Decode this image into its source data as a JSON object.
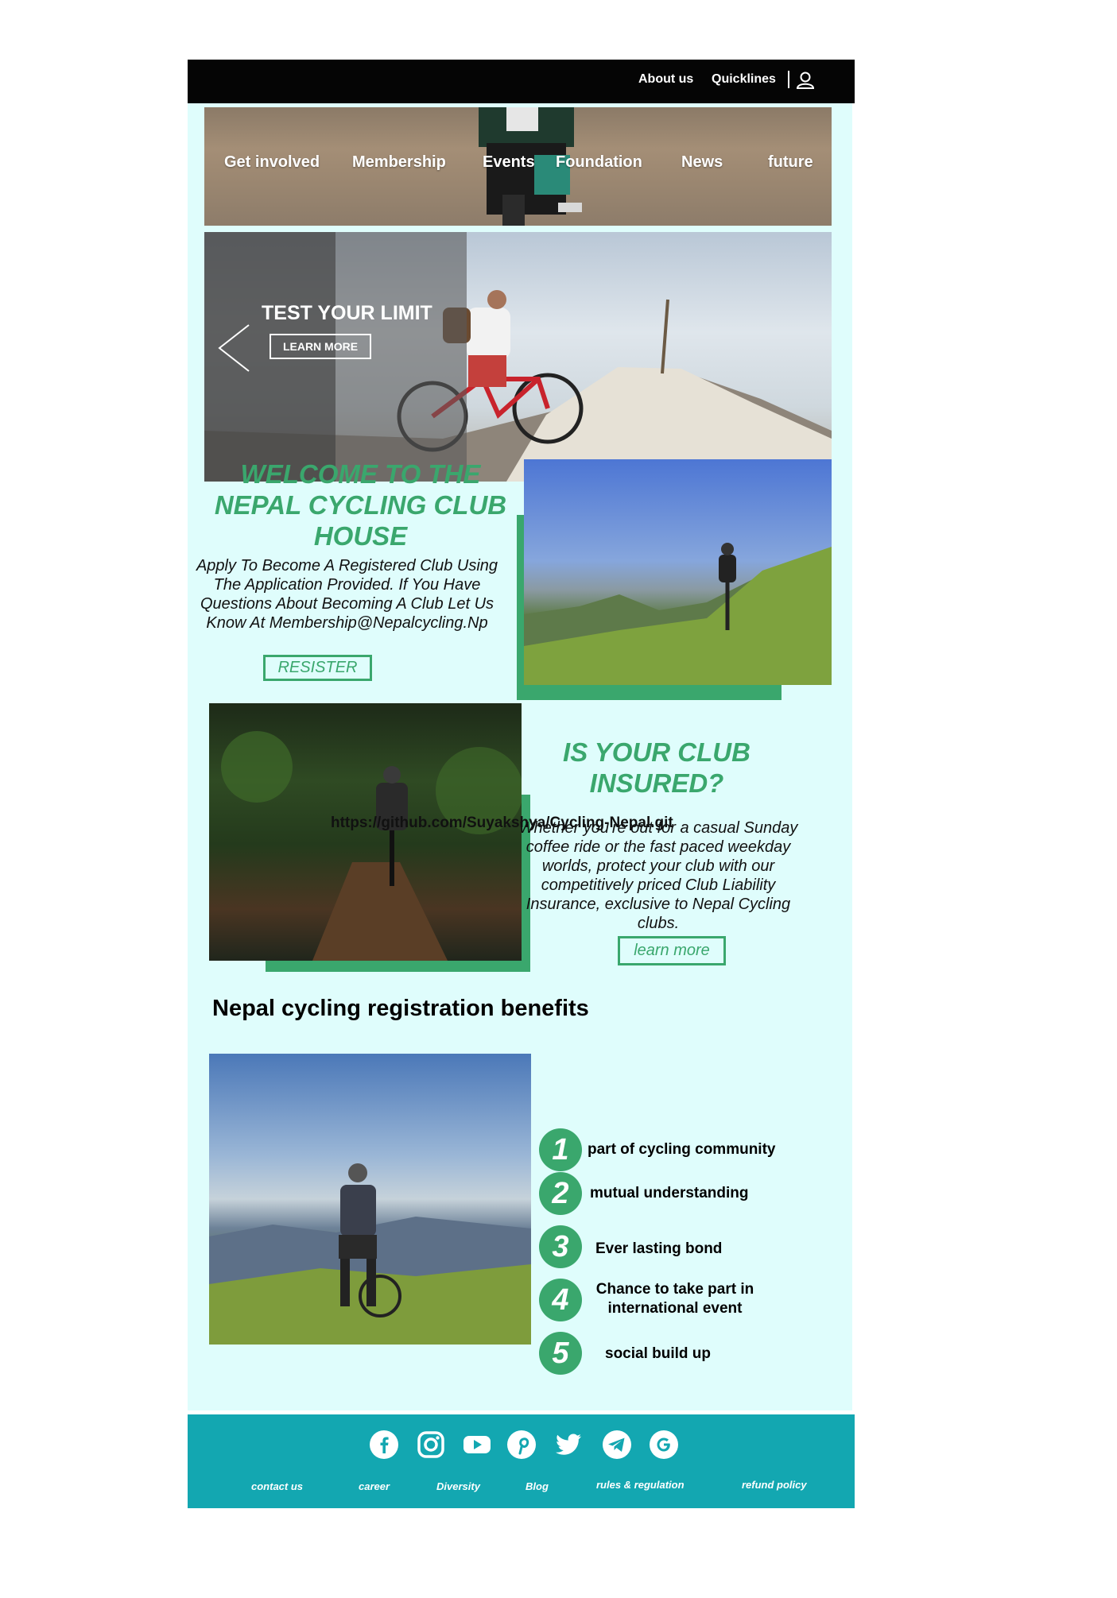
{
  "topbar": {
    "about": "About us",
    "quicklinks": "Quicklines",
    "user_icon": "user-icon"
  },
  "nav": {
    "items": [
      "Get involved",
      "Membership",
      "Events",
      "Foundation",
      "News",
      "future"
    ]
  },
  "hero": {
    "title": "TEST YOUR LIMIT",
    "button": "LEARN MORE",
    "prev_icon": "chevron-left-icon"
  },
  "welcome": {
    "title": "WELCOME TO THE NEPAL CYCLING CLUB HOUSE",
    "text": "Apply To Become A Registered Club Using The Application Provided. If You Have Questions About Becoming A Club Let Us Know At Membership@Nepalcycling.Np",
    "button": "RESISTER"
  },
  "insured": {
    "title": "IS YOUR CLUB INSURED?",
    "text": "Whether you're out for a casual Sunday coffee ride or the fast paced weekday worlds, protect your club with our competitively priced Club Liability Insurance, exclusive to Nepal Cycling clubs.",
    "overlay_link": "https://github.com/Suyakshya/Cycling-Nepal.git",
    "button": "learn more"
  },
  "benefits": {
    "title": "Nepal cycling registration benefits",
    "items": [
      {
        "num": "1",
        "text": "part of cycling community"
      },
      {
        "num": "2",
        "text": "mutual understanding"
      },
      {
        "num": "3",
        "text": "Ever lasting bond"
      },
      {
        "num": "4",
        "text": "Chance to take part in international event"
      },
      {
        "num": "5",
        "text": "social build up"
      }
    ]
  },
  "footer": {
    "social": [
      "facebook-icon",
      "instagram-icon",
      "youtube-icon",
      "pinterest-icon",
      "twitter-icon",
      "telegram-icon",
      "google-icon"
    ],
    "links": [
      "contact us",
      "career",
      "Diversity",
      "Blog",
      "rules & regulation",
      "refund policy"
    ]
  },
  "colors": {
    "accent": "#3aa76d",
    "background": "#dffdfc",
    "topbar": "#050505",
    "footer": "#13a7b1"
  }
}
